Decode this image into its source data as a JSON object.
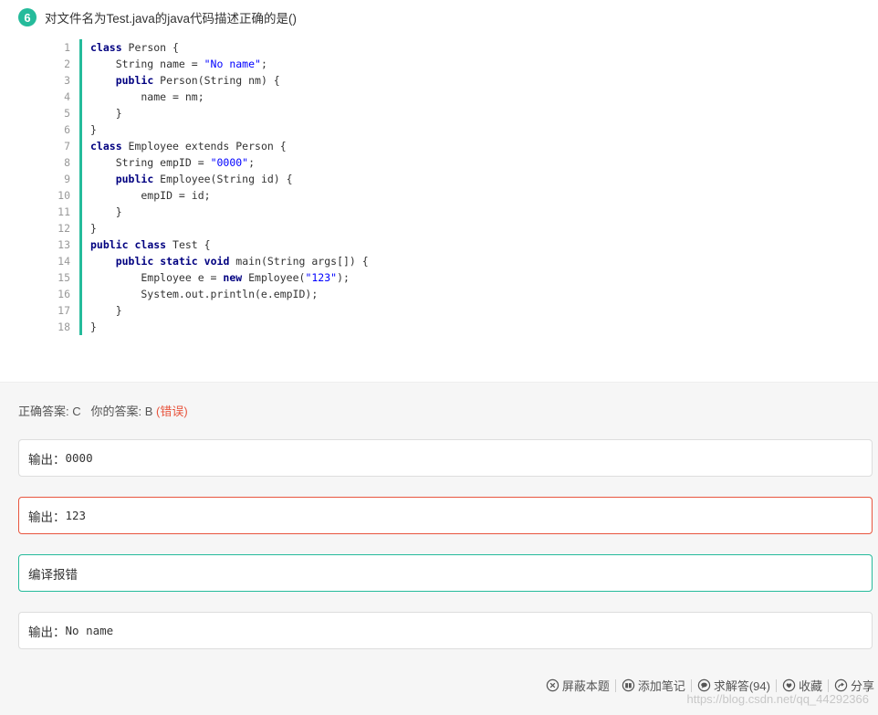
{
  "question": {
    "number": "6",
    "text": "对文件名为Test.java的java代码描述正确的是()"
  },
  "code_lines": [
    {
      "n": "1",
      "tokens": [
        {
          "t": "class",
          "k": "kw"
        },
        {
          "t": " Person {",
          "k": ""
        }
      ]
    },
    {
      "n": "2",
      "tokens": [
        {
          "t": "    String name = ",
          "k": ""
        },
        {
          "t": "\"No name\"",
          "k": "str"
        },
        {
          "t": ";",
          "k": ""
        }
      ]
    },
    {
      "n": "3",
      "tokens": [
        {
          "t": "    ",
          "k": ""
        },
        {
          "t": "public",
          "k": "kw"
        },
        {
          "t": " Person(String nm) {",
          "k": ""
        }
      ]
    },
    {
      "n": "4",
      "tokens": [
        {
          "t": "        name = nm;",
          "k": ""
        }
      ]
    },
    {
      "n": "5",
      "tokens": [
        {
          "t": "    }",
          "k": ""
        }
      ]
    },
    {
      "n": "6",
      "tokens": [
        {
          "t": "}",
          "k": ""
        }
      ]
    },
    {
      "n": "7",
      "tokens": [
        {
          "t": "class",
          "k": "kw"
        },
        {
          "t": " Employee extends Person {",
          "k": ""
        }
      ]
    },
    {
      "n": "8",
      "tokens": [
        {
          "t": "    String empID = ",
          "k": ""
        },
        {
          "t": "\"0000\"",
          "k": "str"
        },
        {
          "t": ";",
          "k": ""
        }
      ]
    },
    {
      "n": "9",
      "tokens": [
        {
          "t": "    ",
          "k": ""
        },
        {
          "t": "public",
          "k": "kw"
        },
        {
          "t": " Employee(String id) {",
          "k": ""
        }
      ]
    },
    {
      "n": "10",
      "tokens": [
        {
          "t": "        empID = id;",
          "k": ""
        }
      ]
    },
    {
      "n": "11",
      "tokens": [
        {
          "t": "    }",
          "k": ""
        }
      ]
    },
    {
      "n": "12",
      "tokens": [
        {
          "t": "}",
          "k": ""
        }
      ]
    },
    {
      "n": "13",
      "tokens": [
        {
          "t": "public",
          "k": "kw"
        },
        {
          "t": " ",
          "k": ""
        },
        {
          "t": "class",
          "k": "kw"
        },
        {
          "t": " Test {",
          "k": ""
        }
      ]
    },
    {
      "n": "14",
      "tokens": [
        {
          "t": "    ",
          "k": ""
        },
        {
          "t": "public",
          "k": "kw"
        },
        {
          "t": " ",
          "k": ""
        },
        {
          "t": "static",
          "k": "kw"
        },
        {
          "t": " ",
          "k": ""
        },
        {
          "t": "void",
          "k": "kw"
        },
        {
          "t": " main(String args[]) {",
          "k": ""
        }
      ]
    },
    {
      "n": "15",
      "tokens": [
        {
          "t": "        Employee e = ",
          "k": ""
        },
        {
          "t": "new",
          "k": "kw"
        },
        {
          "t": " Employee(",
          "k": ""
        },
        {
          "t": "\"123\"",
          "k": "str"
        },
        {
          "t": ");",
          "k": ""
        }
      ]
    },
    {
      "n": "16",
      "tokens": [
        {
          "t": "        System.out.println(e.empID);",
          "k": ""
        }
      ]
    },
    {
      "n": "17",
      "tokens": [
        {
          "t": "    }",
          "k": ""
        }
      ]
    },
    {
      "n": "18",
      "tokens": [
        {
          "t": "}",
          "k": ""
        }
      ]
    }
  ],
  "answer": {
    "correct_label": "正确答案: ",
    "correct_value": "C",
    "yours_label": "你的答案: ",
    "yours_value": "B",
    "status": "(错误)"
  },
  "options": [
    {
      "label": "输出：",
      "value": "0000",
      "state": "normal"
    },
    {
      "label": "输出：",
      "value": "123",
      "state": "wrong"
    },
    {
      "label": "编译报错",
      "value": "",
      "state": "correct"
    },
    {
      "label": "输出：",
      "value": "No name",
      "state": "normal"
    }
  ],
  "actions": {
    "block": "屏蔽本题",
    "note": "添加笔记",
    "ask": "求解答(94)",
    "fav": "收藏",
    "share": "分享"
  },
  "watermark": "https://blog.csdn.net/qq_44292366",
  "colors": {
    "accent": "#25bb9b",
    "error": "#e8553e"
  }
}
